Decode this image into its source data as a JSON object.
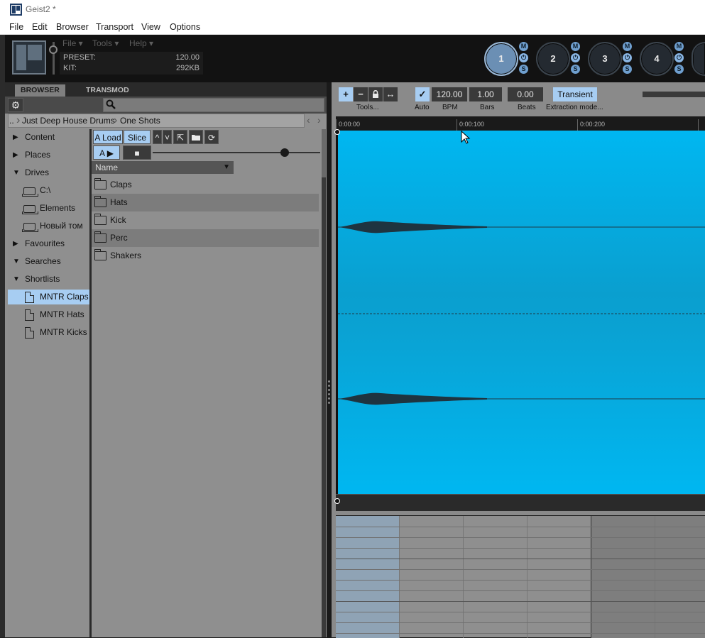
{
  "window": {
    "title": "Geist2 *"
  },
  "menubar": [
    "File",
    "Edit",
    "Browser",
    "Transport",
    "View",
    "Options"
  ],
  "header": {
    "menus": [
      "File ▾",
      "Tools ▾",
      "Help ▾"
    ],
    "preset_label": "PRESET:",
    "preset_value": "120.00",
    "kit_label": "KIT:",
    "kit_value": "292KB"
  },
  "engines": [
    {
      "label": "1",
      "active": true
    },
    {
      "label": "2",
      "active": false
    },
    {
      "label": "3",
      "active": false
    },
    {
      "label": "4",
      "active": false
    }
  ],
  "engine_buttons": {
    "mute": "M",
    "power": "⏻",
    "solo": "S"
  },
  "browser": {
    "tabs": [
      "BROWSER",
      "TRANSMOD"
    ],
    "search_placeholder": "",
    "breadcrumb": [
      "..",
      "Just Deep House Drums",
      "One Shots"
    ],
    "tree": [
      {
        "label": "Content",
        "type": "collapsed"
      },
      {
        "label": "Places",
        "type": "collapsed"
      },
      {
        "label": "Drives",
        "type": "expanded"
      },
      {
        "label": "C:\\",
        "type": "drive"
      },
      {
        "label": "Elements",
        "type": "drive"
      },
      {
        "label": "Новый том",
        "type": "drive"
      },
      {
        "label": "Favourites",
        "type": "collapsed"
      },
      {
        "label": "Searches",
        "type": "expanded"
      },
      {
        "label": "Shortlists",
        "type": "expanded"
      },
      {
        "label": "MNTR Claps",
        "type": "doc",
        "selected": true
      },
      {
        "label": "MNTR Hats",
        "type": "doc"
      },
      {
        "label": "MNTR Kicks",
        "type": "doc"
      }
    ],
    "toolbar": {
      "load": "A Load",
      "slice": "Slice",
      "up": "^",
      "down": "˅",
      "play_a": "A ▶",
      "stop": "■"
    },
    "playback_level": 0.79,
    "column_header": "Name",
    "files": [
      "Claps",
      "Hats",
      "Kick",
      "Perc",
      "Shakers"
    ]
  },
  "editor": {
    "tools_label": "Tools...",
    "auto_label": "Auto",
    "bpm_value": "120.00",
    "bpm_label": "BPM",
    "bars_value": "1.00",
    "bars_label": "Bars",
    "beats_value": "0.00",
    "beats_label": "Beats",
    "extraction_value": "Transient",
    "extraction_label": "Extraction mode...",
    "ruler": [
      "0:00:00",
      "0:00:100",
      "0:00:200"
    ]
  },
  "colors": {
    "accent": "#a7cdf2",
    "waveform_bg": "#00b7f1",
    "panel_bg": "#909090"
  }
}
